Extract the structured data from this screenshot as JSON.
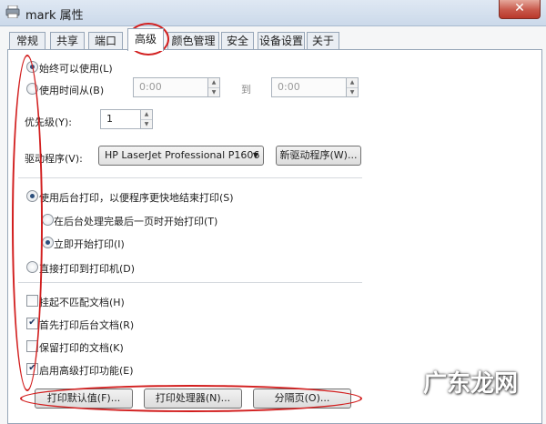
{
  "window": {
    "title": "mark 属性",
    "close_glyph": "✕"
  },
  "tabs": [
    {
      "label": "常规"
    },
    {
      "label": "共享"
    },
    {
      "label": "端口"
    },
    {
      "label": "高级",
      "active": true
    },
    {
      "label": "颜色管理"
    },
    {
      "label": "安全"
    },
    {
      "label": "设备设置"
    },
    {
      "label": "关于"
    }
  ],
  "availability": {
    "always_label": "始终可以使用(L)",
    "always_selected": true,
    "from_label": "使用时间从(B)",
    "from_selected": false,
    "from_time": "0:00",
    "to_label": "到",
    "to_time": "0:00"
  },
  "priority": {
    "label": "优先级(Y):",
    "value": "1"
  },
  "driver": {
    "label": "驱动程序(V):",
    "selected": "HP LaserJet Professional P1606",
    "new_driver_button": "新驱动程序(W)..."
  },
  "spooling": {
    "spool_label": "使用后台打印，以便程序更快地结束打印(S)",
    "spool_selected": true,
    "after_last_page_label": "在后台处理完最后一页时开始打印(T)",
    "after_last_page_selected": false,
    "immediately_label": "立即开始打印(I)",
    "immediately_selected": true,
    "direct_label": "直接打印到打印机(D)",
    "direct_selected": false
  },
  "options": [
    {
      "label": "挂起不匹配文档(H)",
      "checked": false
    },
    {
      "label": "首先打印后台文档(R)",
      "checked": true
    },
    {
      "label": "保留打印的文档(K)",
      "checked": false
    },
    {
      "label": "启用高级打印功能(E)",
      "checked": true
    }
  ],
  "bottom_buttons": {
    "defaults": "打印默认值(F)...",
    "processor": "打印处理器(N)...",
    "separator": "分隔页(O)..."
  },
  "watermark": {
    "text": "广东龙网"
  },
  "colors": {
    "annotation_red": "#d21f1f",
    "selected_tab": "#ffffff",
    "panel_border": "#97a6b8"
  }
}
